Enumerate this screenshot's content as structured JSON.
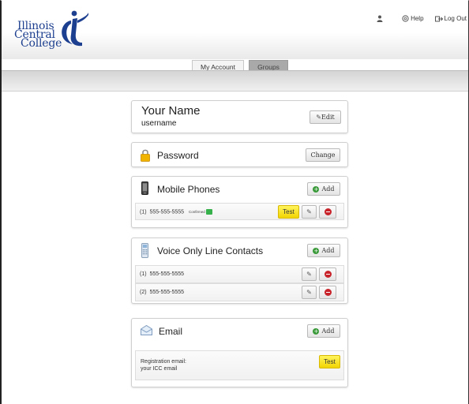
{
  "header": {
    "logo_lines": [
      "Illinois",
      "Central",
      "College"
    ],
    "help_label": "Help",
    "logout_label": "Log Out"
  },
  "tabs": [
    {
      "label": "My Account",
      "active": true
    },
    {
      "label": "Groups",
      "active": false
    }
  ],
  "profile": {
    "name": "Your Name",
    "username": "username",
    "edit_label": "Edit"
  },
  "password": {
    "title": "Password",
    "change_label": "Change"
  },
  "mobile": {
    "title": "Mobile Phones",
    "add_label": "Add",
    "rows": [
      {
        "index": "(1)",
        "number": "555-555-5555",
        "status": "Confirmed",
        "test_label": "Test"
      }
    ]
  },
  "voice": {
    "title": "Voice Only Line Contacts",
    "add_label": "Add",
    "rows": [
      {
        "index": "(1)",
        "number": "555-555-5555"
      },
      {
        "index": "(2)",
        "number": "555-555-5555"
      }
    ]
  },
  "email": {
    "title": "Email",
    "add_label": "Add",
    "registration_label": "Registration email:",
    "registration_value": "your ICC email",
    "test_label": "Test"
  },
  "colors": {
    "brand_blue": "#1d3f8f",
    "test_yellow": "#f2d500",
    "add_green": "#3a9a3a",
    "delete_red": "#c8232a"
  }
}
